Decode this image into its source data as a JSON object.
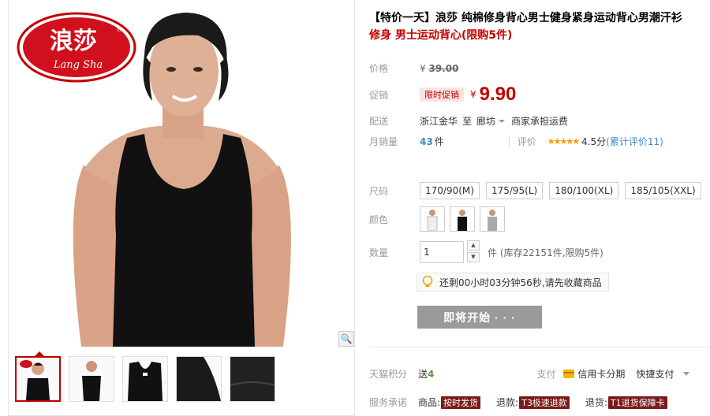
{
  "product": {
    "title": "【特价一天】浪莎 纯棉修身背心男士健身紧身运动背心男潮汗衫",
    "subtitle": "修身 男士运动背心(限购5件)"
  },
  "brand": {
    "logo_text": "浪莎",
    "logo_script": "Lang Sha",
    "logo_mark": "®"
  },
  "price": {
    "label": "价格",
    "currency": "¥",
    "original": "39.00"
  },
  "promo": {
    "label": "促销",
    "badge": "限时促销",
    "currency": "¥",
    "price": "9.90"
  },
  "shipping": {
    "label": "配送",
    "from": "浙江金华",
    "to_word": "至",
    "destination": "廊坊",
    "fee": "商家承担运费"
  },
  "sales": {
    "label": "月销量",
    "count": "43",
    "unit": "件",
    "rating_label": "评价",
    "stars": "★★★★★",
    "score": "4.5分",
    "review_link": "(累计评价11)"
  },
  "size": {
    "label": "尺码",
    "options": [
      "170/90(M)",
      "175/95(L)",
      "180/100(XL)",
      "185/105(XXL)"
    ]
  },
  "color": {
    "label": "颜色"
  },
  "quantity": {
    "label": "数量",
    "value": "1",
    "unit": "件",
    "note": "(库存22151件,限购5件)",
    "up": "▲",
    "down": "▼"
  },
  "countdown": {
    "text": "还剩00小时03分钟56秒,请先收藏商品"
  },
  "action": {
    "start_button": "即将开始 · · ·"
  },
  "points": {
    "label": "天猫积分",
    "give": "送",
    "value": "4"
  },
  "payment": {
    "label": "支付",
    "credit": "信用卡分期",
    "quick": "快捷支付"
  },
  "promise": {
    "label": "服务承诺",
    "items": [
      {
        "prefix": "商品:",
        "tag": "按时发货"
      },
      {
        "prefix": "退款:",
        "tag": "T3极速退款"
      },
      {
        "prefix": "退货:",
        "tag": "T1退货保障卡"
      }
    ]
  },
  "gallery": {
    "zoom_icon": "🔍"
  },
  "colors": {
    "accent": "#c40000",
    "link": "#3b8cc6",
    "button": "#9a9a9a"
  }
}
